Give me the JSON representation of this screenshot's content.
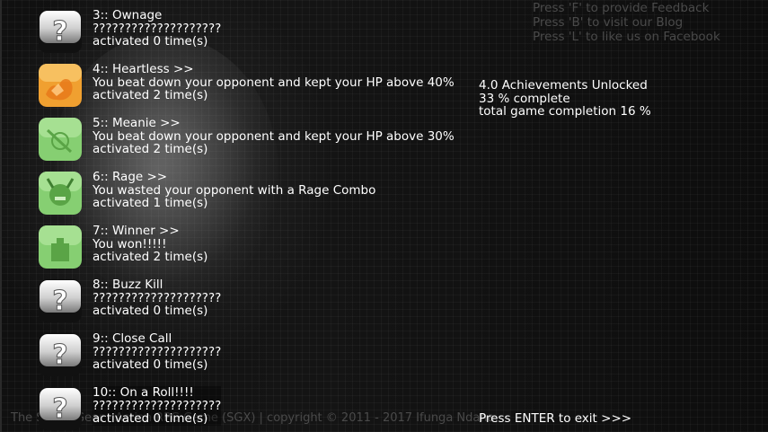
{
  "hints": [
    "Press 'F' to provide Feedback",
    "Press 'B' to visit our Blog",
    "Press 'L' to like us on Facebook"
  ],
  "stats": {
    "unlocked": "4.0 Achievements Unlocked",
    "complete": "33 % complete",
    "total": "total game completion 16 %"
  },
  "achievements": [
    {
      "title": "3:: Ownage",
      "desc": "????????????????????",
      "count": "activated 0 time(s)",
      "icon": "question-mark-icon"
    },
    {
      "title": "4:: Heartless >>",
      "desc": "You beat down your opponent and kept your HP above 40%",
      "count": "activated 2 time(s)",
      "icon": "heartless-icon",
      "color": "#f0a030"
    },
    {
      "title": "5:: Meanie >>",
      "desc": "You beat down your opponent and kept your HP above 30%",
      "count": "activated 2 time(s)",
      "icon": "meanie-icon",
      "color": "#8fd47a"
    },
    {
      "title": "6:: Rage >>",
      "desc": "You wasted your opponent with a Rage Combo",
      "count": "activated 1 time(s)",
      "icon": "rage-icon",
      "color": "#8fd47a"
    },
    {
      "title": "7:: Winner >>",
      "desc": "You won!!!!!",
      "count": "activated 2 time(s)",
      "icon": "winner-icon",
      "color": "#8fd47a"
    },
    {
      "title": "8:: Buzz Kill",
      "desc": "????????????????????",
      "count": "activated 0 time(s)",
      "icon": "question-mark-icon"
    },
    {
      "title": "9:: Close Call",
      "desc": "????????????????????",
      "count": "activated 0 time(s)",
      "icon": "question-mark-icon"
    },
    {
      "title": "10:: On a Roll!!!!",
      "desc": "????????????????????",
      "count": "activated 0 time(s)",
      "icon": "question-mark-icon"
    }
  ],
  "footer": {
    "copyright": "The Street Gear - Action RPG Game (SGX) | copyright © 2011 - 2017 Ifunga Ndana.",
    "exit": "Press ENTER to exit >>>"
  }
}
